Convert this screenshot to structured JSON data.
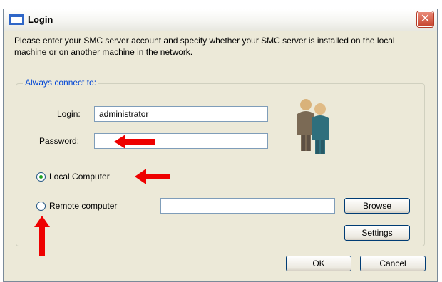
{
  "window": {
    "title": "Login",
    "close_symbol": "✕"
  },
  "intro": {
    "text": "Please enter your SMC server account and specify whether your SMC server is installed on the local machine or on another machine in the network."
  },
  "group": {
    "legend": "Always connect to:",
    "login_label": "Login:",
    "login_value": "administrator",
    "password_label": "Password:",
    "password_value": "",
    "local_label": "Local Computer",
    "local_selected": true,
    "remote_label": "Remote computer",
    "remote_selected": false,
    "remote_value": "",
    "browse_label": "Browse",
    "settings_label": "Settings"
  },
  "footer": {
    "ok_label": "OK",
    "cancel_label": "Cancel"
  },
  "annotation": {
    "arrow_color": "#ee0000"
  },
  "icons": [
    "window-icon",
    "close-icon",
    "users-icon",
    "red-arrow-left",
    "red-arrow-up"
  ]
}
